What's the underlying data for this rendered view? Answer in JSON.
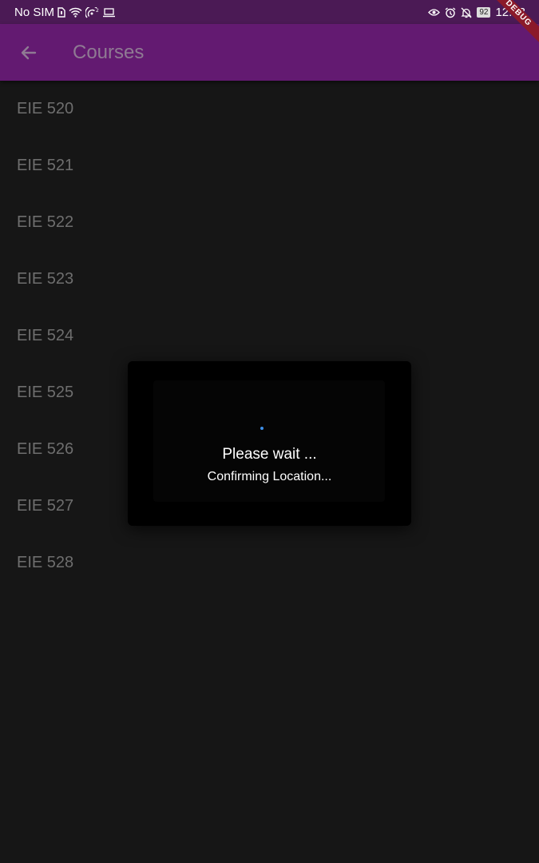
{
  "status_bar": {
    "carrier": "No SIM",
    "battery": "92",
    "time": "12:33",
    "icons": [
      "sim-icon",
      "wifi-icon",
      "hotspot-icon",
      "screen-cast-icon",
      "eye-icon",
      "alarm-icon",
      "notifications-off-icon",
      "battery-icon"
    ]
  },
  "app_bar": {
    "title": "Courses",
    "back_icon": "arrow-back-icon",
    "debug_banner": "DEBUG",
    "color": "#631a71"
  },
  "courses": [
    {
      "label": "EIE 520"
    },
    {
      "label": "EIE 521"
    },
    {
      "label": "EIE 522"
    },
    {
      "label": "EIE 523"
    },
    {
      "label": "EIE 524"
    },
    {
      "label": "EIE 525"
    },
    {
      "label": "EIE 526"
    },
    {
      "label": "EIE 527"
    },
    {
      "label": "EIE 528"
    }
  ],
  "dialog": {
    "title": "Please wait ...",
    "message": "Confirming Location...",
    "spinner_color": "#3d8fe8"
  }
}
